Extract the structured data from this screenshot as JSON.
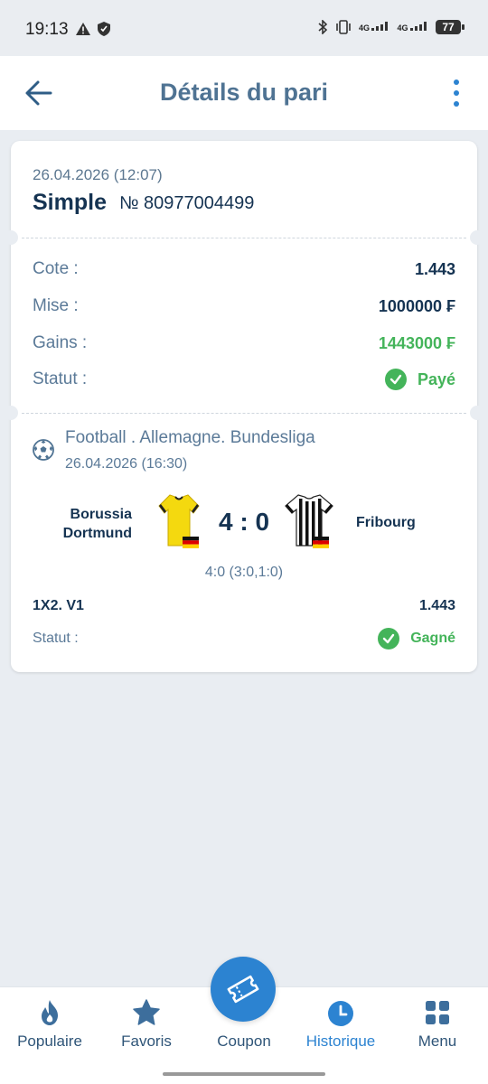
{
  "status_bar": {
    "time": "19:13",
    "battery": "77",
    "net1": "4G",
    "net2": "4G"
  },
  "header": {
    "title": "Détails du pari"
  },
  "bet": {
    "date": "26.04.2026 (12:07)",
    "type": "Simple",
    "number": "№ 80977004499",
    "rows": {
      "cote_label": "Cote :",
      "cote_value": "1.443",
      "mise_label": "Mise :",
      "mise_value": "1000000 ₣",
      "gains_label": "Gains :",
      "gains_value": "1443000 ₣",
      "statut_label": "Statut :",
      "statut_value": "Payé"
    }
  },
  "event": {
    "title": "Football . Allemagne. Bundesliga",
    "date": "26.04.2026 (16:30)",
    "team1_line1": "Borussia",
    "team1_line2": "Dortmund",
    "team2": "Fribourg",
    "score": "4 : 0",
    "score_detail": "4:0 (3:0,1:0)",
    "market": "1X2. V1",
    "market_odd": "1.443",
    "status_label": "Statut :",
    "status_value": "Gagné"
  },
  "nav": {
    "items": [
      {
        "label": "Populaire"
      },
      {
        "label": "Favoris"
      },
      {
        "label": "Coupon"
      },
      {
        "label": "Historique"
      },
      {
        "label": "Menu"
      }
    ]
  },
  "colors": {
    "accent": "#2c83d1",
    "success": "#44b45a",
    "title": "#4f7393",
    "text": "#153352"
  }
}
